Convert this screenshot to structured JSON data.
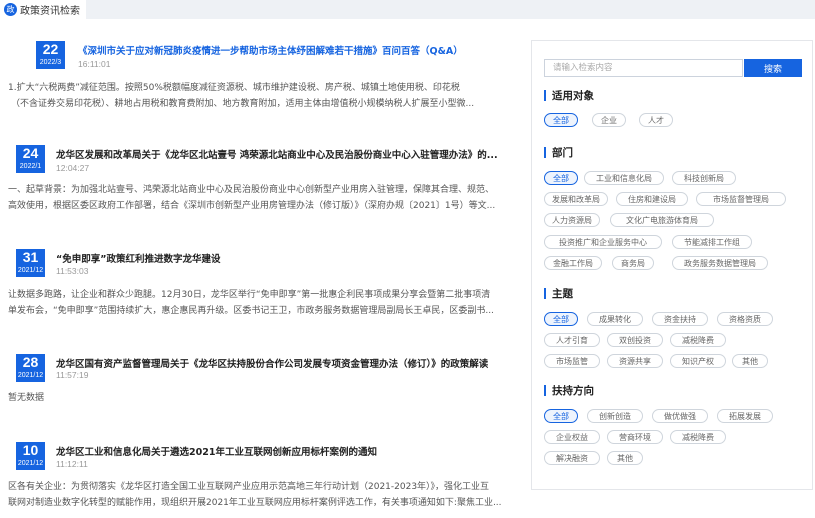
{
  "tab": {
    "icon": "policy-icon",
    "icon_glyph": "政",
    "label": "政策资讯检索"
  },
  "news": [
    {
      "day": "22",
      "ym": "2022/3",
      "title": "《深圳市关于应对新冠肺炎疫情进一步帮助市场主体纾困解难若干措施》百问百答（Q&A）",
      "time": "16:11:01",
      "lines": [
        "1.扩大“六税两费”减征范围。按照50%税额幅度减征资源税、城市维护建设税、房产税、城镇土地使用税、印花税",
        "（不含证券交易印花税）、耕地占用税和教育费附加、地方教育附加，适用主体由增值税小规模纳税人扩展至小型微..."
      ]
    },
    {
      "day": "24",
      "ym": "2022/1",
      "title": "龙华区发展和改革局关于《龙华区北站壹号 鸿荣源北站商业中心及民治股份商业中心入驻管理办法》的...",
      "time": "12:04:27",
      "lines": [
        "一、起草背景：为加强北站壹号、鸿荣源北站商业中心及民治股份商业中心创新型产业用房入驻管理，保障其合理、规范、",
        "高效使用，根据区委区政府工作部署，结合《深圳市创新型产业用房管理办法（修订版）》（深府办规〔2021〕1号）等文..."
      ]
    },
    {
      "day": "31",
      "ym": "2021/12",
      "title": "“免申即享”政策红利推进数字龙华建设",
      "time": "11:53:03",
      "lines": [
        "让数据多跑路，让企业和群众少跑腿。12月30日，龙华区举行“免申即享”第一批惠企利民事项成果分享会暨第二批事项清",
        "单发布会，“免申即享”范围持续扩大，惠企惠民再升级。区委书记王卫，市政务服务数据管理局副局长王卓民，区委副书..."
      ]
    },
    {
      "day": "28",
      "ym": "2021/12",
      "title": "龙华区国有资产监督管理局关于《龙华区扶持股份合作公司发展专项资金管理办法（修订）》的政策解读",
      "time": "11:57:19",
      "lines": [
        "暂无数据"
      ]
    },
    {
      "day": "10",
      "ym": "2021/12",
      "title": "龙华区工业和信息化局关于遴选2021年工业互联网创新应用标杆案例的通知",
      "time": "11:12:11",
      "lines": [
        "区各有关企业：为贯彻落实《龙华区打造全国工业互联网产业应用示范高地三年行动计划（2021-2023年）》，强化工业互",
        "联网对制造业数字化转型的赋能作用，现组织开展2021年工业互联网应用标杆案例评选工作，有关事项通知如下:聚焦工业..."
      ]
    }
  ],
  "search": {
    "placeholder": "请输入检索内容",
    "button": "搜索"
  },
  "filters": {
    "target": {
      "title": "适用对象",
      "chips": [
        "全部",
        "企业",
        "人才"
      ]
    },
    "dept": {
      "title": "部门",
      "chips": [
        "全部",
        "工业和信息化局",
        "科技创新局",
        "发展和改革局",
        "住房和建设局",
        "市场监督管理局",
        "人力资源局",
        "文化广电旅游体育局",
        "投资推广和企业服务中心",
        "节能减排工作组",
        "金融工作局",
        "商务局",
        "政务服务数据管理局"
      ]
    },
    "topic": {
      "title": "主题",
      "chips": [
        "全部",
        "成果转化",
        "资金扶持",
        "资格资质",
        "人才引育",
        "双创投资",
        "减税降费",
        "市场监管",
        "资源共享",
        "知识产权",
        "其他"
      ]
    },
    "direction": {
      "title": "扶持方向",
      "chips": [
        "全部",
        "创新创造",
        "做优做强",
        "拓展发展",
        "企业权益",
        "营商环境",
        "减税降费",
        "解决融资",
        "其他"
      ]
    }
  },
  "colors": {
    "accent": "#1664e0"
  }
}
